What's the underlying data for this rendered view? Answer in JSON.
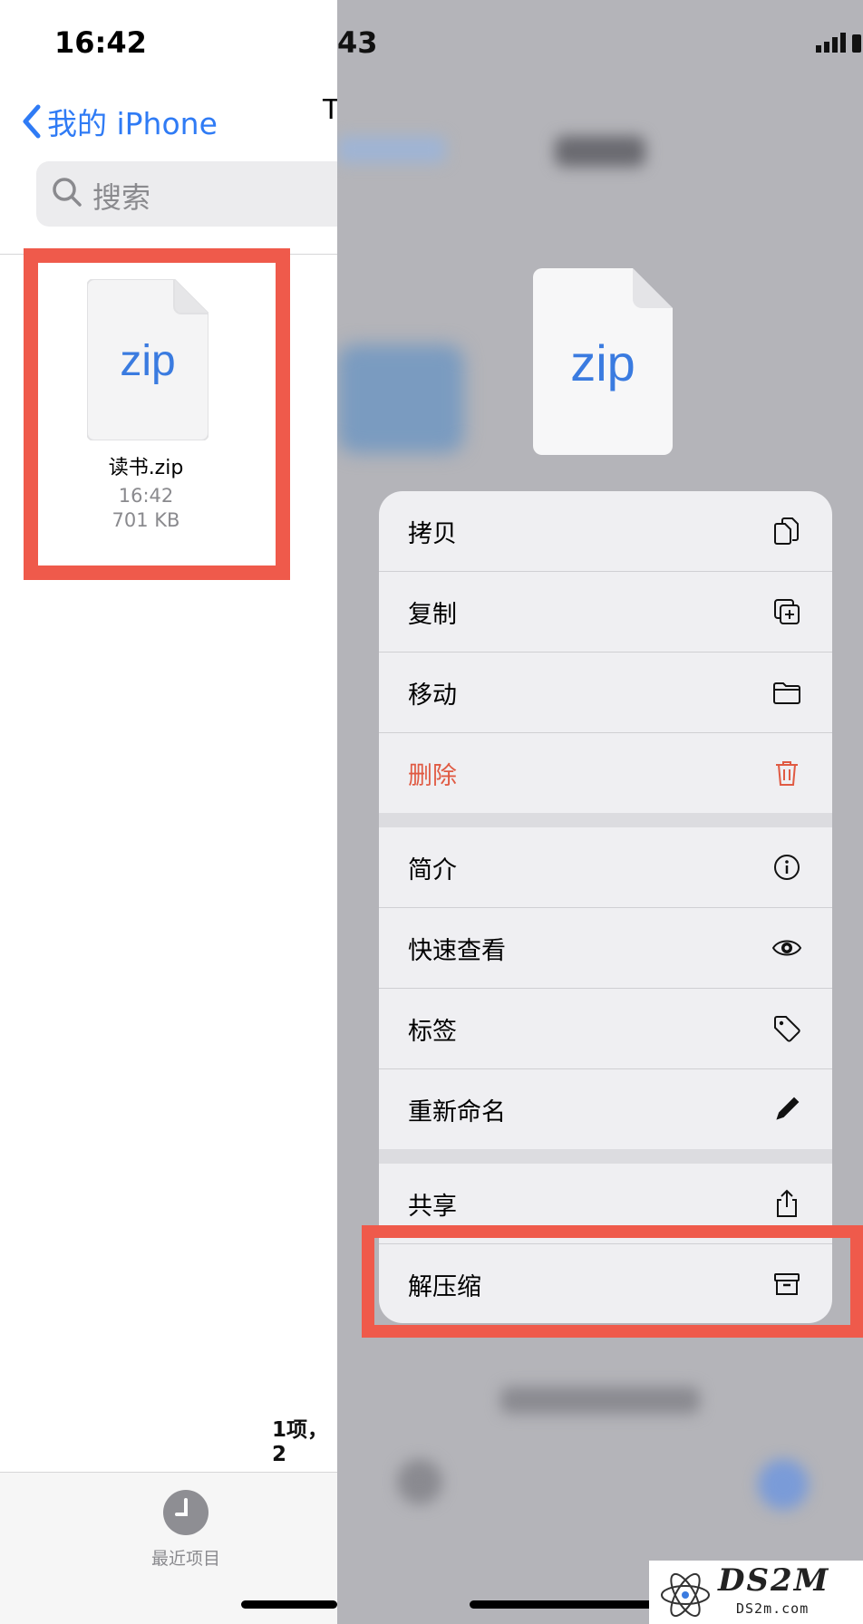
{
  "left": {
    "status_time": "16:42",
    "back_label": "我的 iPhone",
    "title_fragment": "T",
    "search_placeholder": "搜索",
    "file": {
      "type_label": "zip",
      "name": "读书.zip",
      "time": "16:42",
      "size": "701 KB"
    },
    "footer_count": "1项，2",
    "tab_recent_label": "最近项目"
  },
  "right": {
    "status_time_fragment": "43",
    "file_type_label": "zip",
    "menu": {
      "group1": [
        {
          "label": "拷贝",
          "icon": "copy-icon"
        },
        {
          "label": "复制",
          "icon": "duplicate-icon"
        },
        {
          "label": "移动",
          "icon": "folder-icon"
        },
        {
          "label": "删除",
          "icon": "trash-icon",
          "destructive": true
        }
      ],
      "group2": [
        {
          "label": "简介",
          "icon": "info-icon"
        },
        {
          "label": "快速查看",
          "icon": "eye-icon"
        },
        {
          "label": "标签",
          "icon": "tag-icon"
        },
        {
          "label": "重新命名",
          "icon": "pencil-icon"
        }
      ],
      "group3": [
        {
          "label": "共享",
          "icon": "share-icon"
        },
        {
          "label": "解压缩",
          "icon": "archive-icon"
        }
      ]
    }
  },
  "watermark": {
    "text": "DS2M",
    "url": "DS2m.com"
  },
  "colors": {
    "accent": "#2f7bf5",
    "highlight": "#ef5a4b",
    "destructive": "#e05a43"
  }
}
